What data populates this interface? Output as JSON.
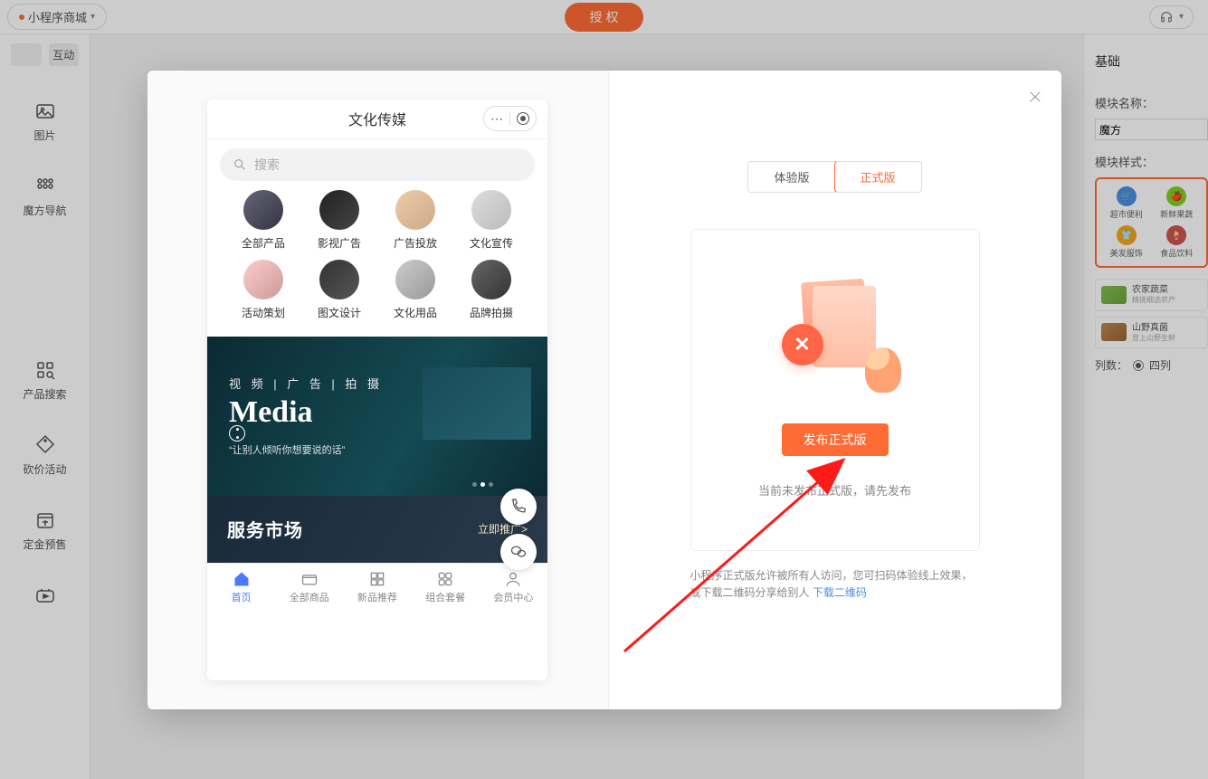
{
  "top": {
    "app_name": "小程序商城",
    "auth_btn": "授 权"
  },
  "sidebar": {
    "tab_interact": "互动",
    "items": [
      {
        "label": "图片"
      },
      {
        "label": "魔方导航"
      },
      {
        "label": "产品搜索"
      },
      {
        "label": "砍价活动"
      },
      {
        "label": "定金预售"
      }
    ]
  },
  "right": {
    "tab": "基础",
    "name_label": "模块名称：",
    "name_value": "魔方",
    "style_label": "模块样式：",
    "pattern": [
      {
        "label": "超市便利",
        "color": "#4a90e2"
      },
      {
        "label": "新鲜果蔬",
        "color": "#7ed321"
      },
      {
        "label": "美发服饰",
        "color": "#f5a623"
      },
      {
        "label": "食品饮料",
        "color": "#d0534f"
      }
    ],
    "styles": [
      {
        "title": "农家蔬菜",
        "sub": "精挑细选农产"
      },
      {
        "title": "山野真菌",
        "sub": "登上山野生鲜"
      }
    ],
    "cols_label": "列数：",
    "cols_value": "四列"
  },
  "phone": {
    "header_title": "文化传媒",
    "search_placeholder": "搜索",
    "categories": [
      {
        "label": "全部产品"
      },
      {
        "label": "影视广告"
      },
      {
        "label": "广告投放"
      },
      {
        "label": "文化宣传"
      },
      {
        "label": "活动策划"
      },
      {
        "label": "图文设计"
      },
      {
        "label": "文化用品"
      },
      {
        "label": "品牌拍摄"
      }
    ],
    "banner": {
      "line1": "视 频 | 广 告 | 拍 摄",
      "line2": "Media",
      "line3": "“让别人倾听你想要说的话”"
    },
    "service": {
      "title": "服务市场",
      "link": "立即推广>"
    },
    "tabs": [
      {
        "label": "首页",
        "active": true
      },
      {
        "label": "全部商品"
      },
      {
        "label": "新品推荐"
      },
      {
        "label": "组合套餐"
      },
      {
        "label": "会员中心"
      }
    ]
  },
  "publish": {
    "tab_trial": "体验版",
    "tab_prod": "正式版",
    "publish_btn": "发布正式版",
    "status": "当前未发布正式版，请先发布",
    "hint_prefix": "小程序正式版允许被所有人访问，您可扫码体验线上效果，或下载二维码分享给别人 ",
    "hint_link": "下载二维码"
  }
}
